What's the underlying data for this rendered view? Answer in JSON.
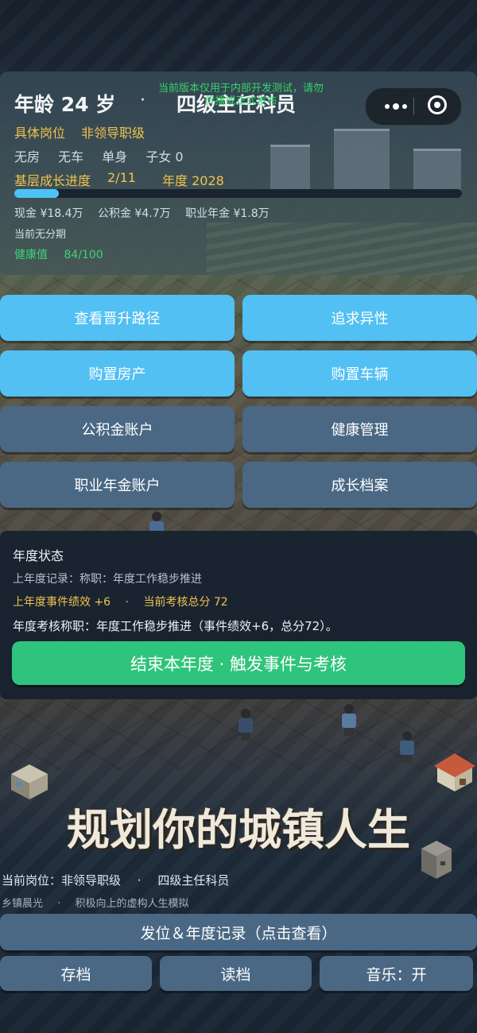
{
  "status": {
    "age": "年龄 24 岁",
    "separator": "·",
    "rank": "四级主任科员",
    "dev_note": "当前版本仅用于内部开发测试，请勿传播或正式发布",
    "post_label": "具体岗位",
    "post_value": "非领导职级",
    "assets": [
      "无房",
      "无车",
      "单身",
      "子女 0"
    ],
    "progress_label": "基层成长进度",
    "progress_count": "2/11",
    "progress_fraction": 0.1,
    "year": "年度 2028",
    "money": [
      "现金 ¥18.4万",
      "公积金 ¥4.7万",
      "职业年金 ¥1.8万"
    ],
    "installment": "当前无分期",
    "health_label": "健康值",
    "health_value": "84/100"
  },
  "actions": [
    {
      "label": "查看晋升路径",
      "style": "blue"
    },
    {
      "label": "追求异性",
      "style": "blue"
    },
    {
      "label": "购置房产",
      "style": "blue"
    },
    {
      "label": "购置车辆",
      "style": "blue"
    },
    {
      "label": "公积金账户",
      "style": "slate"
    },
    {
      "label": "健康管理",
      "style": "slate"
    },
    {
      "label": "职业年金账户",
      "style": "slate"
    },
    {
      "label": "成长档案",
      "style": "slate"
    }
  ],
  "annual": {
    "title": "年度状态",
    "last_record": "上年度记录：称职：年度工作稳步推进",
    "last_perf": "上年度事件绩效 +6",
    "dot": "·",
    "score": "当前考核总分 72",
    "result": "年度考核称职：年度工作稳步推进（事件绩效+6，总分72）。",
    "end_button": "结束本年度 · 触发事件与考核"
  },
  "footer": {
    "big_title": "规划你的城镇人生",
    "current_post_label": "当前岗位：非领导职级",
    "current_post_dot": "·",
    "current_post_rank": "四级主任科员",
    "tagline_left": "乡镇晨光",
    "tagline_dot": "·",
    "tagline_right": "积极向上的虚构人生模拟",
    "record_button": "发位＆年度记录（点击查看）",
    "save_button": "存档",
    "load_button": "读档",
    "music_button": "音乐：开"
  },
  "colors": {
    "accent_blue": "#52c0f3",
    "slate_button": "#4a6884",
    "green_button": "#2fc47b",
    "gold_text": "#f0c24c",
    "health_green": "#3fd27a"
  }
}
